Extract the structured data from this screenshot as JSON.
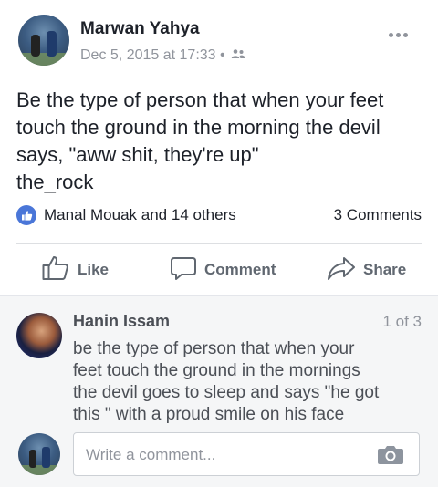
{
  "post": {
    "author": "Marwan Yahya",
    "timestamp": "Dec 5, 2015 at 17:33",
    "separator": "•",
    "privacy_icon": "friends-icon",
    "text_lines": [
      "Be the type of person that when your feet",
      "touch the ground in the morning the devil",
      "says, \"aww shit, they're up\"",
      "the_rock"
    ]
  },
  "reactions": {
    "summary": "Manal Mouak and 14 others",
    "comment_count": "3 Comments"
  },
  "actions": {
    "like_label": "Like",
    "comment_label": "Comment",
    "share_label": "Share"
  },
  "comment": {
    "author": "Hanin Issam",
    "pager": "1 of 3",
    "text_lines": [
      "be the type of person that when your",
      "feet touch the ground in the mornings",
      "the devil goes to sleep and says \"he got",
      "this \" with a proud smile on his face"
    ]
  },
  "composer": {
    "placeholder": "Write a comment..."
  },
  "colors": {
    "like_blue": "#4a76d8",
    "meta_gray": "#90949c",
    "comment_bg": "#f5f6f7"
  }
}
